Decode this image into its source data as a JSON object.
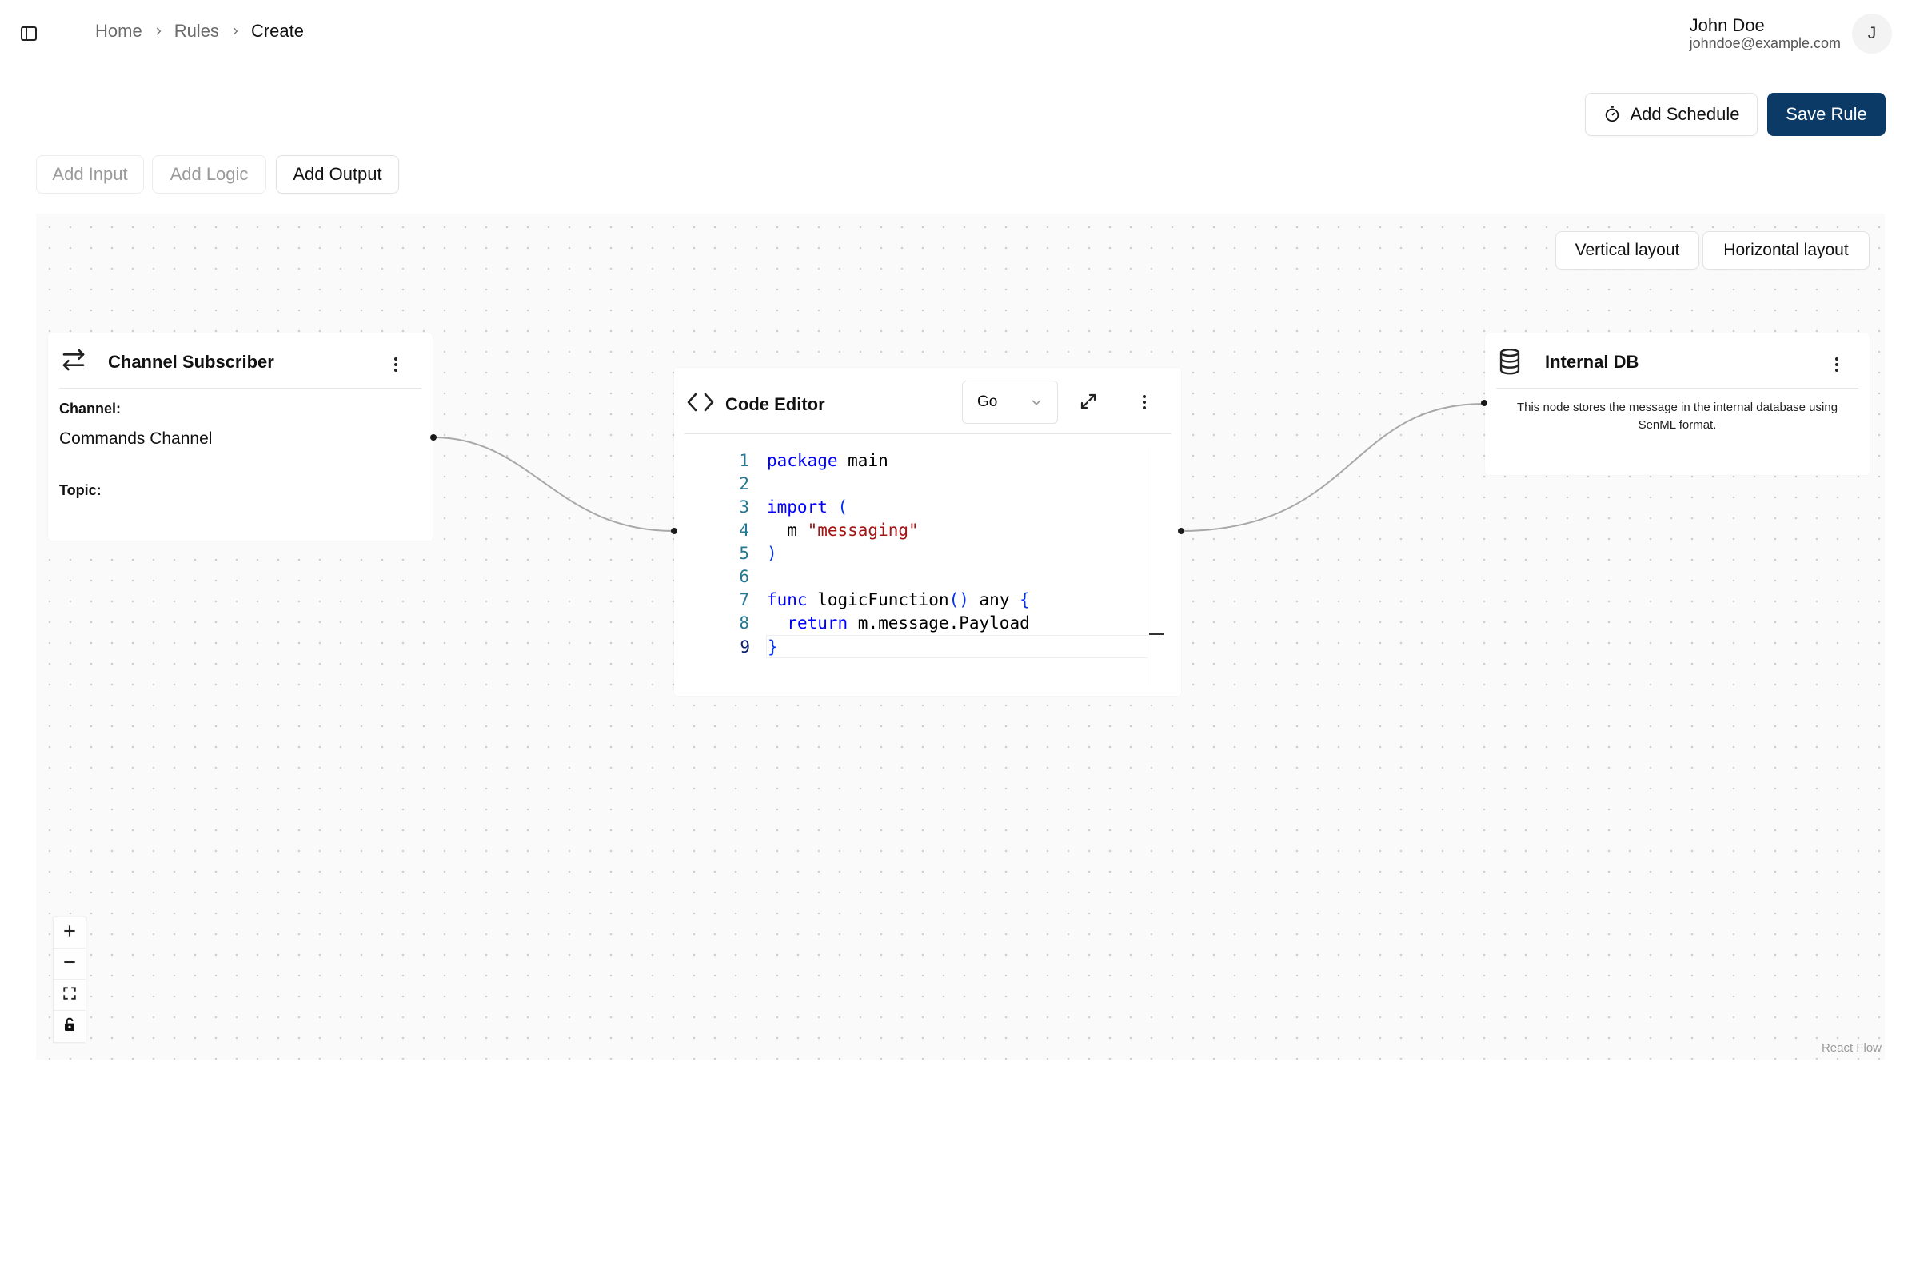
{
  "breadcrumb": {
    "items": [
      "Home",
      "Rules",
      "Create"
    ]
  },
  "user": {
    "name": "John Doe",
    "email": "johndoe@example.com",
    "avatar_initial": "J"
  },
  "actions": {
    "add_schedule": "Add Schedule",
    "save_rule": "Save Rule"
  },
  "toolbar": {
    "add_input": "Add Input",
    "add_logic": "Add Logic",
    "add_output": "Add Output"
  },
  "layout_buttons": {
    "vertical": "Vertical layout",
    "horizontal": "Horizontal layout"
  },
  "nodes": {
    "channel_subscriber": {
      "title": "Channel Subscriber",
      "channel_label": "Channel:",
      "channel_value": "Commands Channel",
      "topic_label": "Topic:",
      "topic_value": ""
    },
    "code_editor": {
      "title": "Code Editor",
      "language": "Go",
      "lines": [
        {
          "n": "1",
          "tokens": [
            {
              "t": "package",
              "c": "kw"
            },
            {
              "t": " main",
              "c": ""
            }
          ]
        },
        {
          "n": "2",
          "tokens": []
        },
        {
          "n": "3",
          "tokens": [
            {
              "t": "import",
              "c": "kw"
            },
            {
              "t": " ",
              "c": ""
            },
            {
              "t": "(",
              "c": "brk"
            }
          ]
        },
        {
          "n": "4",
          "tokens": [
            {
              "t": "  m ",
              "c": ""
            },
            {
              "t": "\"messaging\"",
              "c": "str"
            }
          ]
        },
        {
          "n": "5",
          "tokens": [
            {
              "t": ")",
              "c": "brk"
            }
          ]
        },
        {
          "n": "6",
          "tokens": []
        },
        {
          "n": "7",
          "tokens": [
            {
              "t": "func",
              "c": "kw"
            },
            {
              "t": " logicFunction",
              "c": ""
            },
            {
              "t": "()",
              "c": "brk"
            },
            {
              "t": " any ",
              "c": ""
            },
            {
              "t": "{",
              "c": "brk"
            }
          ]
        },
        {
          "n": "8",
          "tokens": [
            {
              "t": "  ",
              "c": ""
            },
            {
              "t": "return",
              "c": "kw"
            },
            {
              "t": " m.message.Payload",
              "c": ""
            }
          ]
        },
        {
          "n": "9",
          "tokens": [
            {
              "t": "}",
              "c": "brk"
            }
          ]
        }
      ]
    },
    "internal_db": {
      "title": "Internal DB",
      "description": "This node stores the message in the internal database using SenML format."
    }
  },
  "canvas": {
    "attribution": "React Flow"
  },
  "colors": {
    "primary": "#0b3a66",
    "keyword": "#0000ff",
    "string": "#a31515",
    "line_number": "#237893"
  }
}
